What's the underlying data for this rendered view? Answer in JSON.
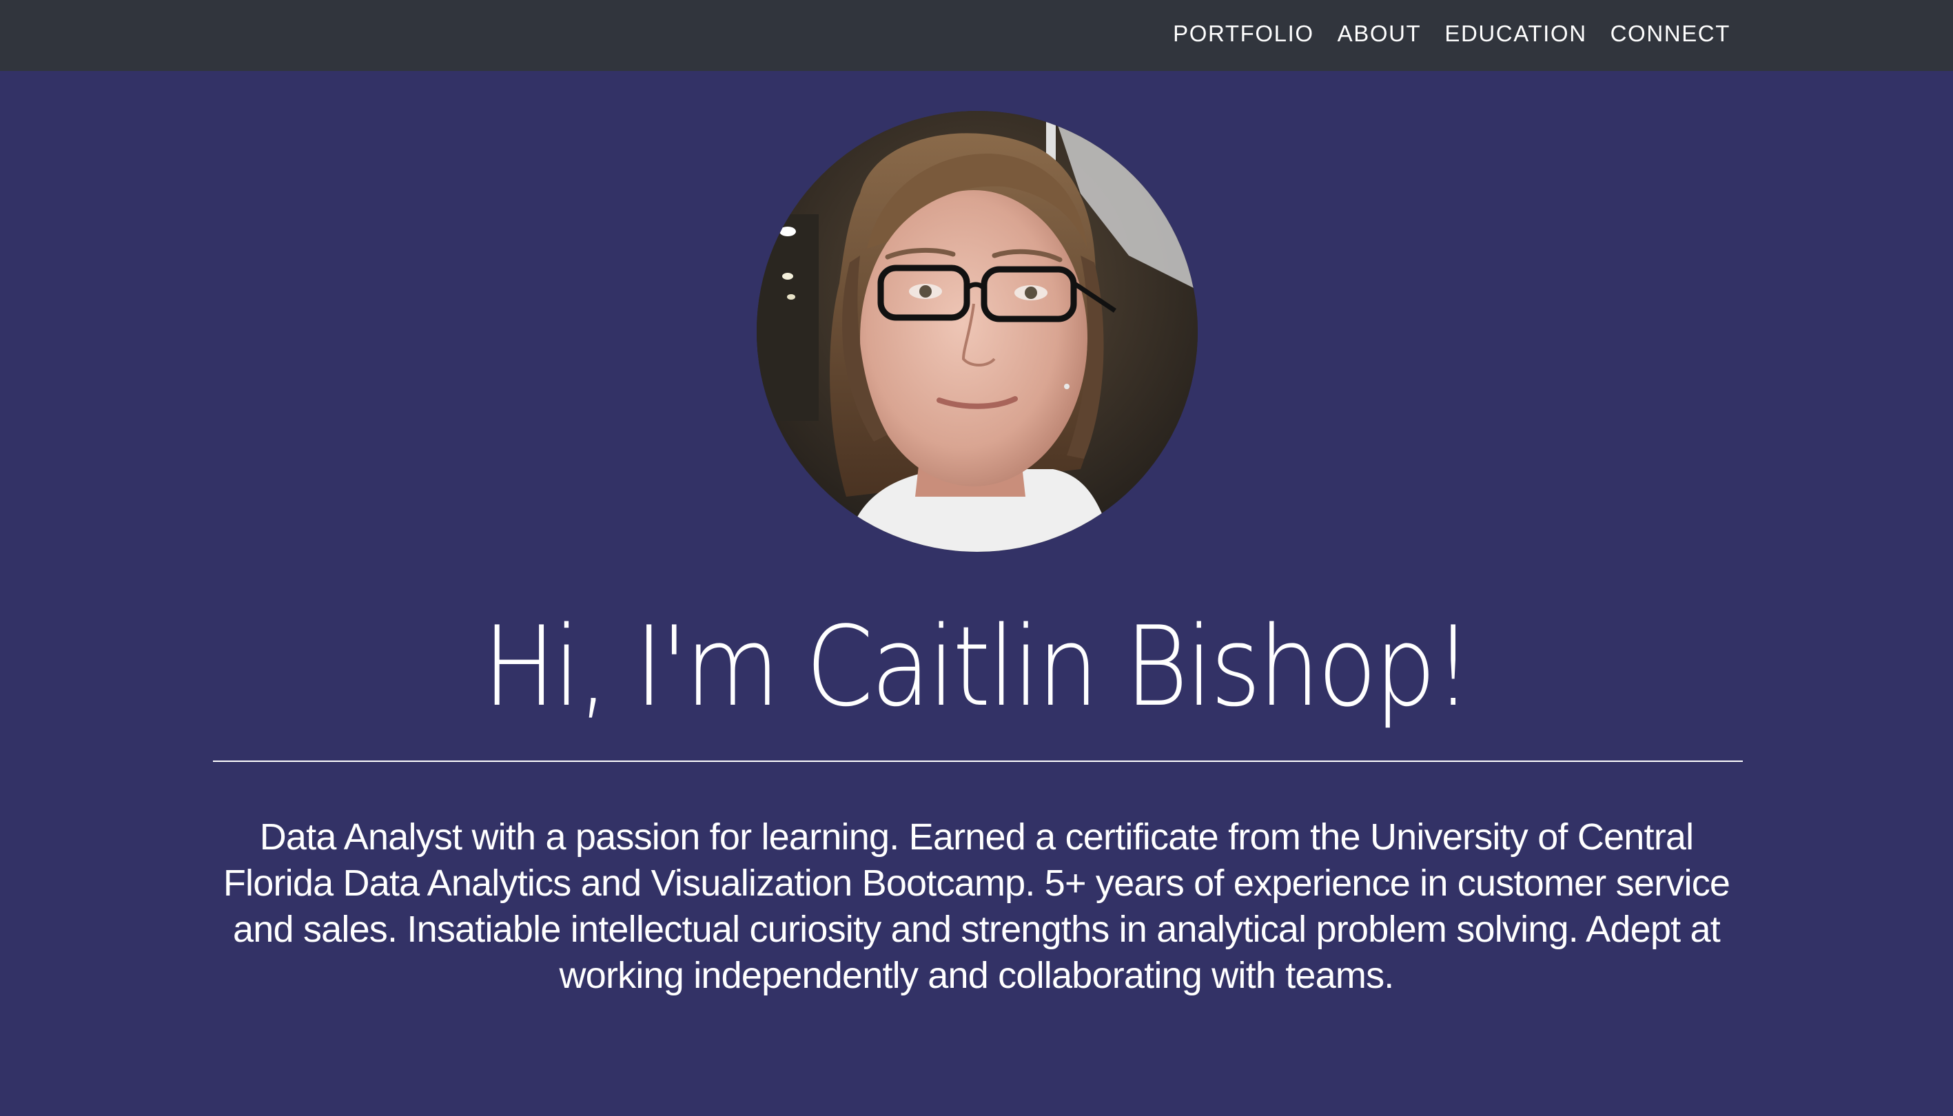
{
  "nav": {
    "items": [
      {
        "label": "PORTFOLIO"
      },
      {
        "label": "ABOUT"
      },
      {
        "label": "EDUCATION"
      },
      {
        "label": "CONNECT"
      }
    ]
  },
  "hero": {
    "title": "Hi, I'm Caitlin Bishop!",
    "bio": "Data Analyst with a passion for learning. Earned a certificate from the University of Central Florida Data Analytics and Visualization Bootcamp. 5+ years of experience in customer service and sales. Insatiable intellectual curiosity and strengths in analytical problem solving. Adept at working independently and collaborating with teams."
  },
  "colors": {
    "page_background": "#333266",
    "navbar_background": "#31353d",
    "text": "#ffffff"
  }
}
